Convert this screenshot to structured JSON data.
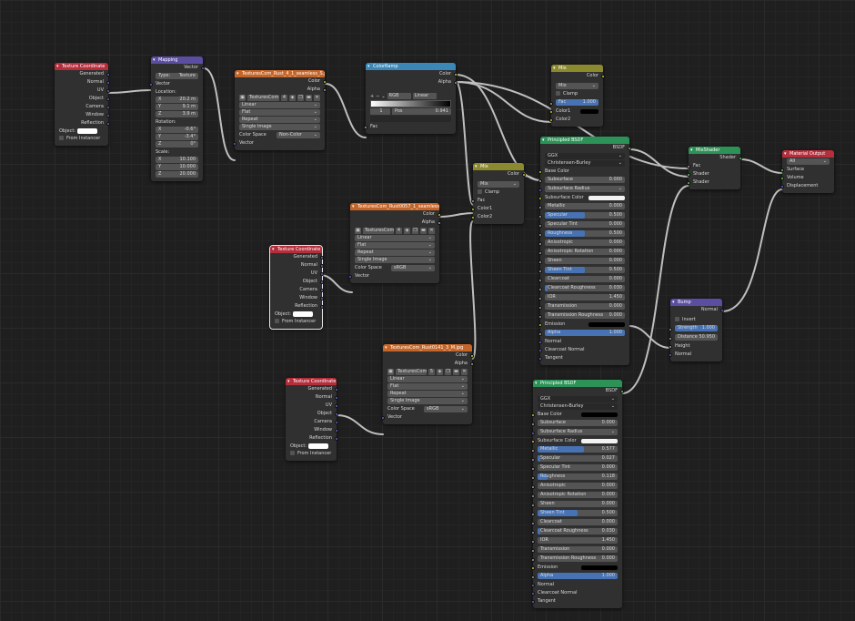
{
  "tc1": {
    "title": "Texture Coordinate",
    "outs": [
      "Generated",
      "Normal",
      "UV",
      "Object",
      "Camera",
      "Window",
      "Reflection"
    ],
    "object_label": "Object:",
    "from_instancer": "From Instancer"
  },
  "map": {
    "title": "Mapping",
    "out": "Vector",
    "type_label": "Type:",
    "type_val": "Texture",
    "vector_in": "Vector",
    "loc_label": "Location:",
    "loc": [
      [
        "X",
        "20.2 m"
      ],
      [
        "Y",
        "9.1 m"
      ],
      [
        "Z",
        "3.9 m"
      ]
    ],
    "rot_label": "Rotation:",
    "rot": [
      [
        "X",
        "-0.6°"
      ],
      [
        "Y",
        "-3.4°"
      ],
      [
        "Z",
        "0°"
      ]
    ],
    "scale_label": "Scale:",
    "scale": [
      [
        "X",
        "10.100"
      ],
      [
        "Y",
        "10.000"
      ],
      [
        "Z",
        "20.000"
      ]
    ]
  },
  "img1": {
    "title": "TexturesCom_Rust_4_1_seamless_S.jpg",
    "out_color": "Color",
    "out_alpha": "Alpha",
    "file": "TexturesCom...",
    "users": "4",
    "interp": "Linear",
    "proj": "Flat",
    "ext": "Repeat",
    "src": "Single Image",
    "cs_label": "Color Space",
    "cs_val": "Non-Color",
    "vector": "Vector"
  },
  "ramp": {
    "title": "ColorRamp",
    "out_color": "Color",
    "out_alpha": "Alpha",
    "plus": "+",
    "minus": "−",
    "mode": "RGB",
    "interp": "Linear",
    "index": "1",
    "pos_label": "Pos",
    "pos_val": "0.941",
    "fac": "Fac"
  },
  "mix1": {
    "title": "Mix",
    "out": "Color",
    "blend": "Mix",
    "clamp": "Clamp",
    "fac_label": "Fac",
    "fac_val": "1.000",
    "fac_pct": 100,
    "c1": "Color1",
    "c2": "Color2"
  },
  "mix2": {
    "title": "Mix",
    "out": "Color",
    "blend": "Mix",
    "clamp": "Clamp",
    "fac": "Fac",
    "c1": "Color1",
    "c2": "Color2"
  },
  "img2": {
    "title": "TexturesCom_Rust0057_1_seamless_S...",
    "out_color": "Color",
    "out_alpha": "Alpha",
    "file": "TexturesCom...",
    "users": "4",
    "interp": "Linear",
    "proj": "Flat",
    "ext": "Repeat",
    "src": "Single Image",
    "cs_label": "Color Space",
    "cs_val": "sRGB",
    "vector": "Vector"
  },
  "tc2": {
    "title": "Texture Coordinate",
    "outs": [
      "Generated",
      "Normal",
      "UV",
      "Object",
      "Camera",
      "Window",
      "Reflection"
    ],
    "object_label": "Object:",
    "from_instancer": "From Instancer"
  },
  "img3": {
    "title": "TexturesCom_Rust0141_3_M.jpg",
    "out_color": "Color",
    "out_alpha": "Alpha",
    "file": "TexturesCom...",
    "users": "5",
    "interp": "Linear",
    "proj": "Flat",
    "ext": "Repeat",
    "src": "Single Image",
    "cs_label": "Color Space",
    "cs_val": "sRGB",
    "vector": "Vector"
  },
  "tc3": {
    "title": "Texture Coordinate",
    "outs": [
      "Generated",
      "Normal",
      "UV",
      "Object",
      "Camera",
      "Window",
      "Reflection"
    ],
    "object_label": "Object:",
    "from_instancer": "From Instancer"
  },
  "bsdf1": {
    "title": "Principled BSDF",
    "out": "BSDF",
    "dist": "GGX",
    "sss": "Christensen-Burley",
    "base": "Base Color",
    "ss": "Subsurface",
    "ss_v": "0.000",
    "ssr": "Subsurface Radius",
    "ssc": "Subsurface Color",
    "rows": [
      [
        "Metallic",
        "0.000",
        0
      ],
      [
        "Specular",
        "0.500",
        50
      ],
      [
        "Specular Tint",
        "0.000",
        0
      ],
      [
        "Roughness",
        "0.500",
        50
      ],
      [
        "Anisotropic",
        "0.000",
        0
      ],
      [
        "Anisotropic Rotation",
        "0.000",
        0
      ],
      [
        "Sheen",
        "0.000",
        0
      ],
      [
        "Sheen Tint",
        "0.500",
        50
      ],
      [
        "Clearcoat",
        "0.000",
        0
      ],
      [
        "Clearcoat Roughness",
        "0.030",
        3
      ],
      [
        "IOR",
        "1.450",
        0
      ],
      [
        "Transmission",
        "0.000",
        0
      ],
      [
        "Transmission Roughness",
        "0.000",
        0
      ]
    ],
    "emission": "Emission",
    "alpha": "Alpha",
    "alpha_v": "1.000",
    "normal": "Normal",
    "ccn": "Clearcoat Normal",
    "tangent": "Tangent"
  },
  "bsdf2": {
    "title": "Principled BSDF",
    "out": "BSDF",
    "dist": "GGX",
    "sss": "Christensen-Burley",
    "base": "Base Color",
    "ss": "Subsurface",
    "ss_v": "0.000",
    "ssr": "Subsurface Radius",
    "ssc": "Subsurface Color",
    "rows": [
      [
        "Metallic",
        "0.577",
        58
      ],
      [
        "Specular",
        "0.027",
        3
      ],
      [
        "Specular Tint",
        "0.000",
        0
      ],
      [
        "Roughness",
        "0.118",
        12
      ],
      [
        "Anisotropic",
        "0.000",
        0
      ],
      [
        "Anisotropic Rotation",
        "0.000",
        0
      ],
      [
        "Sheen",
        "0.000",
        0
      ],
      [
        "Sheen Tint",
        "0.500",
        50
      ],
      [
        "Clearcoat",
        "0.000",
        0
      ],
      [
        "Clearcoat Roughness",
        "0.030",
        3
      ],
      [
        "IOR",
        "1.450",
        0
      ],
      [
        "Transmission",
        "0.000",
        0
      ],
      [
        "Transmission Roughness",
        "0.000",
        0
      ]
    ],
    "emission": "Emission",
    "alpha": "Alpha",
    "alpha_v": "1.000",
    "normal": "Normal",
    "ccn": "Clearcoat Normal",
    "tangent": "Tangent"
  },
  "mixsh": {
    "title": "MixShader",
    "out": "Shader",
    "fac": "Fac",
    "s1": "Shader",
    "s2": "Shader"
  },
  "bump": {
    "title": "Bump",
    "out": "Normal",
    "invert": "Invert",
    "strength_label": "Strength",
    "strength_val": "1.000",
    "distance_label": "Distance",
    "distance_val": "50.950",
    "height": "Height",
    "normal": "Normal"
  },
  "out": {
    "title": "Material Output",
    "target": "All",
    "surface": "Surface",
    "volume": "Volume",
    "displacement": "Displacement"
  }
}
